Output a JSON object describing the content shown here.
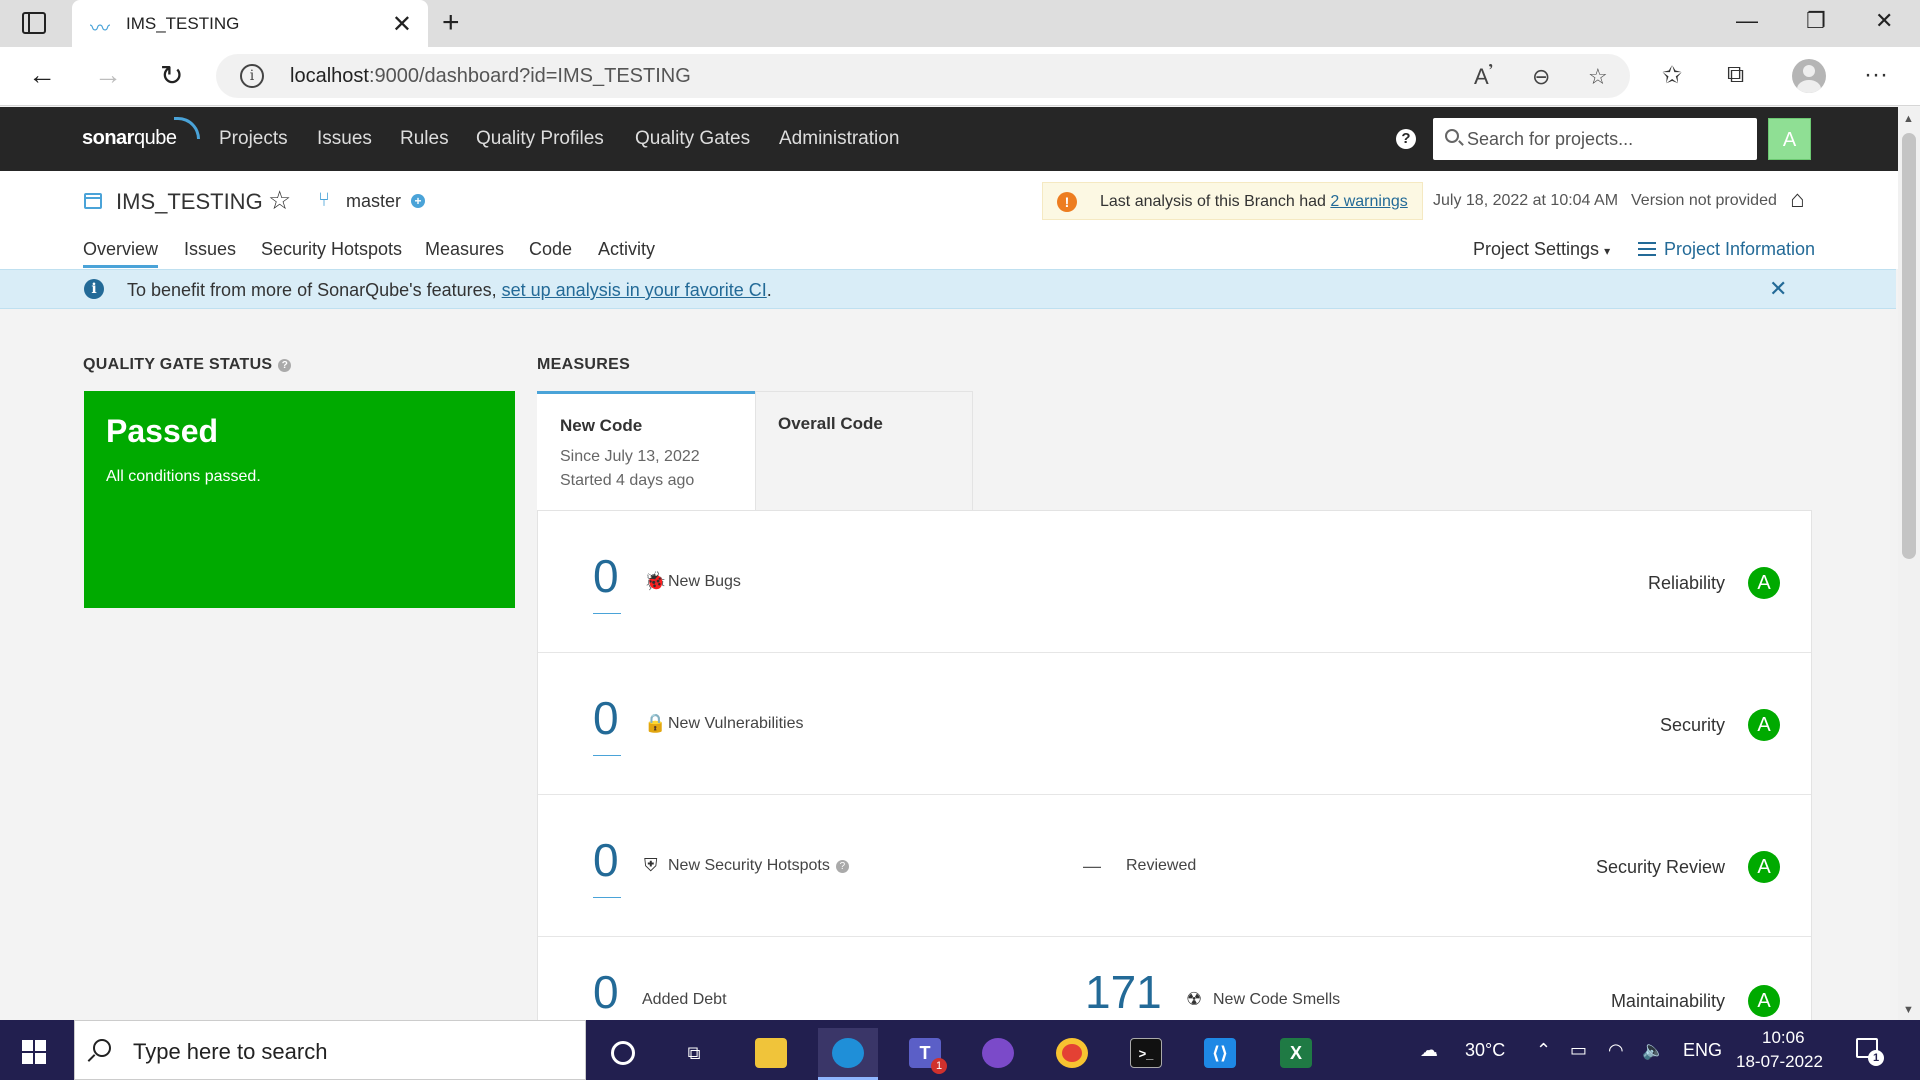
{
  "browser": {
    "tab_title": "IMS_TESTING",
    "url_host": "localhost",
    "url_path": ":9000/dashboard?id=IMS_TESTING"
  },
  "sonar": {
    "logo_bold": "sonar",
    "logo_light": "qube",
    "nav": [
      "Projects",
      "Issues",
      "Rules",
      "Quality Profiles",
      "Quality Gates",
      "Administration"
    ],
    "help": "?",
    "search_placeholder": "Search for projects...",
    "user_initial": "A"
  },
  "project": {
    "name": "IMS_TESTING",
    "branch": "master",
    "warning_text": "Last analysis of this Branch had ",
    "warning_link": "2 warnings",
    "analysis_date": "July 18, 2022 at 10:04 AM",
    "version": "Version not provided",
    "tabs": [
      "Overview",
      "Issues",
      "Security Hotspots",
      "Measures",
      "Code",
      "Activity"
    ],
    "settings_label": "Project Settings",
    "info_label": "Project Information"
  },
  "banner": {
    "text": "To benefit from more of SonarQube's features, ",
    "link": "set up analysis in your favorite CI",
    "tail": "."
  },
  "quality_gate": {
    "title": "QUALITY GATE STATUS",
    "status": "Passed",
    "detail": "All conditions passed.",
    "color": "#00aa00"
  },
  "measures": {
    "title": "MEASURES",
    "new_code_tab": "New Code",
    "new_code_since": "Since July 13, 2022",
    "new_code_started": "Started 4 days ago",
    "overall_tab": "Overall Code",
    "rows": [
      {
        "value": "0",
        "label": "New Bugs",
        "category": "Reliability",
        "grade": "A",
        "icon": "bug-icon"
      },
      {
        "value": "0",
        "label": "New Vulnerabilities",
        "category": "Security",
        "grade": "A",
        "icon": "lock-icon"
      },
      {
        "value": "0",
        "label": "New Security Hotspots",
        "category": "Security Review",
        "grade": "A",
        "icon": "shield-icon",
        "reviewed_value": "—",
        "reviewed_label": "Reviewed"
      },
      {
        "value": "0",
        "label": "Added Debt",
        "category": "Maintainability",
        "grade": "A",
        "smells_value": "171",
        "smells_label": "New Code Smells"
      }
    ]
  },
  "taskbar": {
    "search_text": "Type here to search",
    "weather": "30°C",
    "language": "ENG",
    "time": "10:06",
    "date": "18-07-2022",
    "teams_badge": "1",
    "notif_count": "1"
  }
}
